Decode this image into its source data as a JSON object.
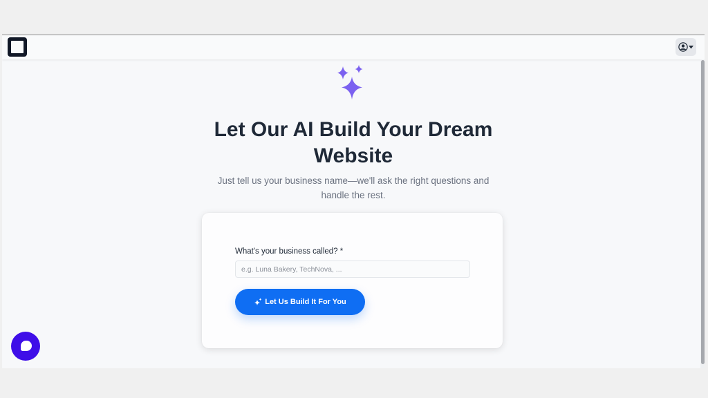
{
  "header": {
    "logo_icon": "square-logo-icon",
    "account_icon": "user-circle-icon",
    "account_dropdown_icon": "caret-down-icon"
  },
  "hero": {
    "icon": "sparkles-icon",
    "title": "Let Our AI Build Your Dream Website",
    "subtitle": "Just tell us your business name—we'll ask the right questions and handle the rest."
  },
  "form": {
    "label": "What's your business called? *",
    "input_value": "",
    "input_placeholder": "e.g. Luna Bakery, TechNova, ...",
    "submit_label": "Let Us Build It For You",
    "submit_icon": "sparkles-icon"
  },
  "chat": {
    "icon": "chat-bubble-icon"
  },
  "colors": {
    "accent": "#0f6ef3",
    "sparkle": "#7b61f0",
    "chat": "#3f0ee8",
    "title": "#1f2937",
    "subtitle": "#6b7280"
  }
}
